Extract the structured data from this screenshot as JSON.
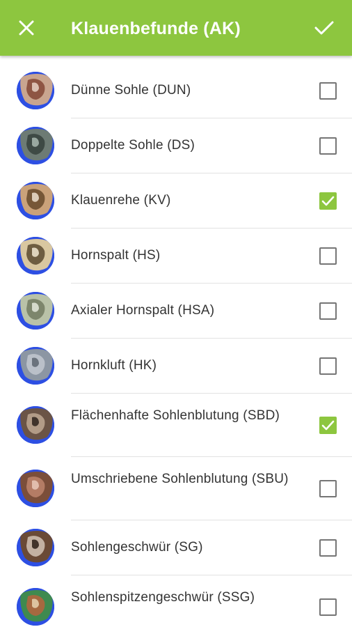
{
  "appbar": {
    "title": "Klauenbefunde (AK)",
    "close_icon": "close-icon",
    "confirm_icon": "check-icon",
    "background_color": "#8dc63f"
  },
  "findings": [
    {
      "label": "Dünne Sohle (DUN)",
      "checked": false,
      "thumbnail": "hoof-photo"
    },
    {
      "label": "Doppelte Sohle (DS)",
      "checked": false,
      "thumbnail": "hoof-photo"
    },
    {
      "label": "Klauenrehe (KV)",
      "checked": true,
      "thumbnail": "hoof-photo"
    },
    {
      "label": "Hornspalt (HS)",
      "checked": false,
      "thumbnail": "hoof-photo"
    },
    {
      "label": "Axialer Hornspalt (HSA)",
      "checked": false,
      "thumbnail": "hoof-photo"
    },
    {
      "label": "Hornkluft (HK)",
      "checked": false,
      "thumbnail": "hoof-photo"
    },
    {
      "label": "Flächenhafte Sohlenblutung (SBD)",
      "checked": true,
      "thumbnail": "hoof-photo"
    },
    {
      "label": "Umschriebene Sohlenblutung (SBU)",
      "checked": false,
      "thumbnail": "hoof-photo"
    },
    {
      "label": "Sohlengeschwür (SG)",
      "checked": false,
      "thumbnail": "hoof-photo"
    },
    {
      "label": "Sohlenspitzengeschwür (SSG)",
      "checked": false,
      "thumbnail": "hoof-photo"
    }
  ],
  "colors": {
    "accent": "#8dc63f",
    "thumb_background": "#2d4fe3",
    "divider": "#e2e2e2",
    "text": "#333333"
  }
}
